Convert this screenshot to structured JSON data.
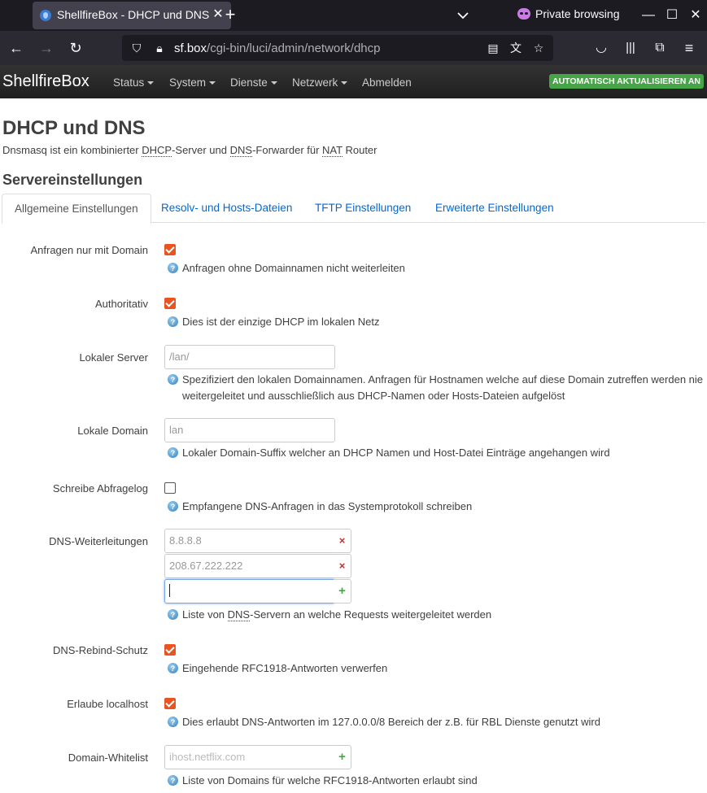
{
  "browser": {
    "tab_title": "ShellfireBox - DHCP und DNS",
    "url_host": "sf.box",
    "url_path": "/cgi-bin/luci/admin/network/dhcp",
    "private_label": "Private browsing"
  },
  "header": {
    "brand": "ShellfireBox",
    "menu": [
      "Status",
      "System",
      "Dienste",
      "Netzwerk",
      "Abmelden"
    ],
    "auto_refresh": "AUTOMATISCH AKTUALISIEREN AN",
    "auto_refresh_color": "#46a546"
  },
  "page": {
    "title": "DHCP und DNS",
    "desc_parts": [
      "Dnsmasq ist ein kombinierter ",
      "DHCP",
      "-Server und ",
      "DNS",
      "-Forwarder für ",
      "NAT",
      " Router"
    ],
    "section_title": "Servereinstellungen"
  },
  "tabs": [
    "Allgemeine Einstellungen",
    "Resolv- und Hosts-Dateien",
    "TFTP Einstellungen",
    "Erweiterte Einstellungen"
  ],
  "fields": {
    "domain_needed": {
      "label": "Anfragen nur mit Domain",
      "checked": true,
      "help": "Anfragen ohne Domainnamen nicht weiterleiten"
    },
    "authoritative": {
      "label": "Authoritativ",
      "checked": true,
      "help": "Dies ist der einzige DHCP im lokalen Netz"
    },
    "local_server": {
      "label": "Lokaler Server",
      "placeholder": "/lan/",
      "help_line1": "Spezifiziert den lokalen Domainnamen. Anfragen für Hostnamen welche auf diese Domain zutreffen werden nie",
      "help_line2": "weitergeleitet und ausschließlich aus DHCP-Namen oder Hosts-Dateien aufgelöst"
    },
    "local_domain": {
      "label": "Lokale Domain",
      "placeholder": "lan",
      "help": "Lokaler Domain-Suffix welcher an DHCP Namen und Host-Datei Einträge angehangen wird"
    },
    "log_queries": {
      "label": "Schreibe Abfragelog",
      "checked": false,
      "help": "Empfangene DNS-Anfragen in das Systemprotokoll schreiben"
    },
    "dns_forwardings": {
      "label": "DNS-Weiterleitungen",
      "values": [
        "8.8.8.8",
        "208.67.222.222"
      ],
      "help_parts": [
        "Liste von ",
        "DNS",
        "-Servern an welche Requests weitergeleitet werden"
      ]
    },
    "rebind_protection": {
      "label": "DNS-Rebind-Schutz",
      "checked": true,
      "help": "Eingehende RFC1918-Antworten verwerfen"
    },
    "rebind_localhost": {
      "label": "Erlaube localhost",
      "checked": true,
      "help": "Dies erlaubt DNS-Antworten im 127.0.0.0/8 Bereich der z.B. für RBL Dienste genutzt wird"
    },
    "domain_whitelist": {
      "label": "Domain-Whitelist",
      "placeholder": "ihost.netflix.com",
      "help": "Liste von Domains für welche RFC1918-Antworten erlaubt sind"
    }
  },
  "icons": {
    "remove": "×",
    "add": "+"
  }
}
